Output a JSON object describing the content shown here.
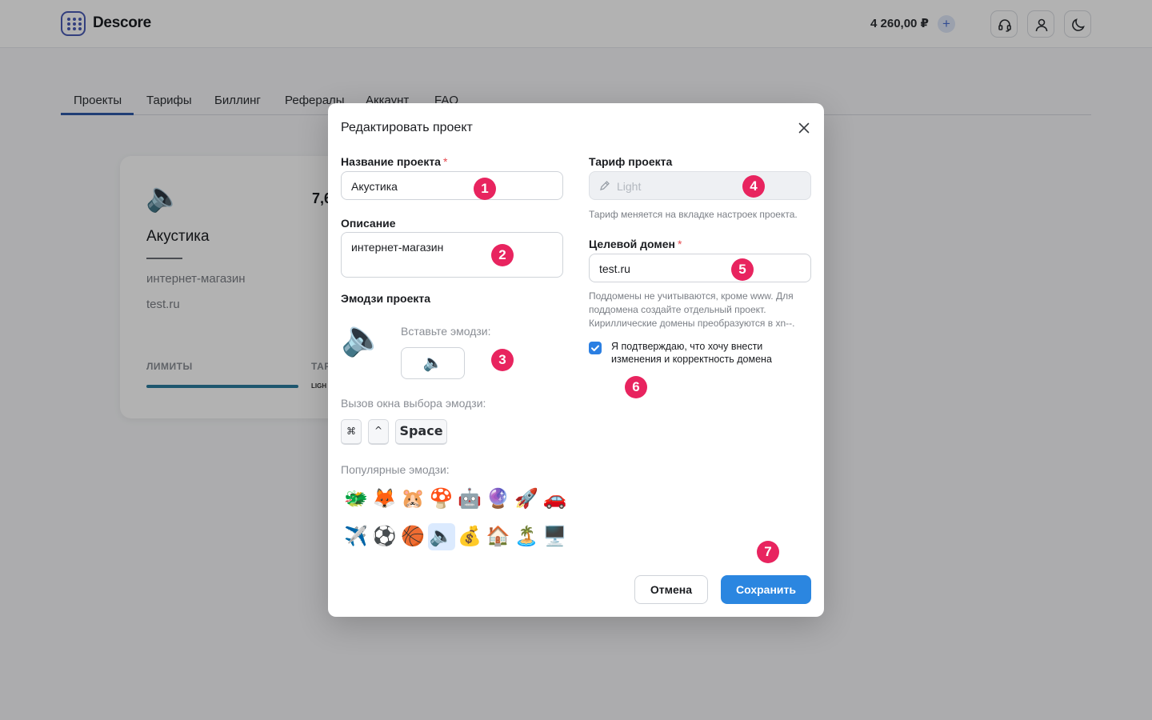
{
  "header": {
    "brand": "Descore",
    "balance": "4 260,00 ₽",
    "balance_add": "+"
  },
  "tabs": [
    "Проекты",
    "Тарифы",
    "Биллинг",
    "Рефералы",
    "Аккаунт",
    "FAQ"
  ],
  "card": {
    "emoji": "🔈",
    "number": "7,6",
    "title": "Акустика",
    "description": "интернет-магазин",
    "domain": "test.ru",
    "limits_label": "ЛИМИТЫ",
    "tariff_label": "ТАР",
    "tariff_value": "LIGH"
  },
  "modal": {
    "title": "Редактировать проект",
    "name_label": "Название проекта",
    "name_value": "Акустика",
    "required_mark": "*",
    "desc_label": "Описание",
    "desc_value": "интернет-магазин",
    "emoji_label": "Эмодзи проекта",
    "emoji_current": "🔈",
    "emoji_insert_label": "Вставьте эмодзи:",
    "emoji_input_value": "🔈",
    "picker_label": "Вызов окна выбора эмодзи:",
    "keys": [
      "⌘",
      "^",
      "Space"
    ],
    "popular_label": "Популярные эмодзи:",
    "popular_emojis": [
      "🐲",
      "🦊",
      "🐹",
      "🍄",
      "🤖",
      "🔮",
      "🚀",
      "🚗",
      "✈️",
      "⚽",
      "🏀",
      "🔈",
      "💰",
      "🏠",
      "🏝️",
      "🖥️"
    ],
    "selected_emoji_index": 11,
    "tariff_label": "Тариф проекта",
    "tariff_value": "Light",
    "tariff_hint": "Тариф меняется на вкладке настроек проекта.",
    "domain_label": "Целевой домен",
    "domain_value": "test.ru",
    "domain_hint": [
      "Поддомены не учитываются, кроме www. Для",
      "поддомена создайте отдельный проект.",
      "Кириллические домены преобразуются в xn--."
    ],
    "confirm_label": "Я подтверждаю, что хочу внести изменения и корректность домена",
    "confirm_checked": true,
    "cancel_label": "Отмена",
    "save_label": "Сохранить"
  },
  "markers": [
    "1",
    "2",
    "3",
    "4",
    "5",
    "6",
    "7"
  ],
  "colors": {
    "accent": "#2b86e0",
    "marker": "#e8245f",
    "tab_active": "#2f5aa8"
  }
}
